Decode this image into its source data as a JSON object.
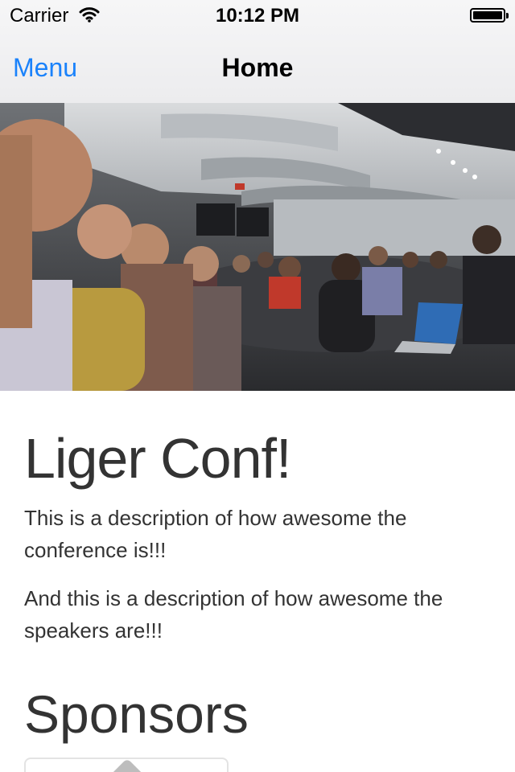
{
  "status_bar": {
    "carrier": "Carrier",
    "time": "10:12 PM",
    "icons": [
      "wifi-icon",
      "battery-icon"
    ]
  },
  "nav_bar": {
    "left_button": "Menu",
    "title": "Home"
  },
  "hero_image": {
    "description_icon": "conference-audience-photo"
  },
  "content": {
    "title": "Liger Conf!",
    "paragraphs": [
      "This is a description of how awesome the conference is!!!",
      "And this is a description of how awesome the speakers are!!!"
    ],
    "sponsors_heading": "Sponsors"
  },
  "colors": {
    "accent": "#1a82fb",
    "text": "#333333",
    "nav_background": "#f2f2f4"
  }
}
